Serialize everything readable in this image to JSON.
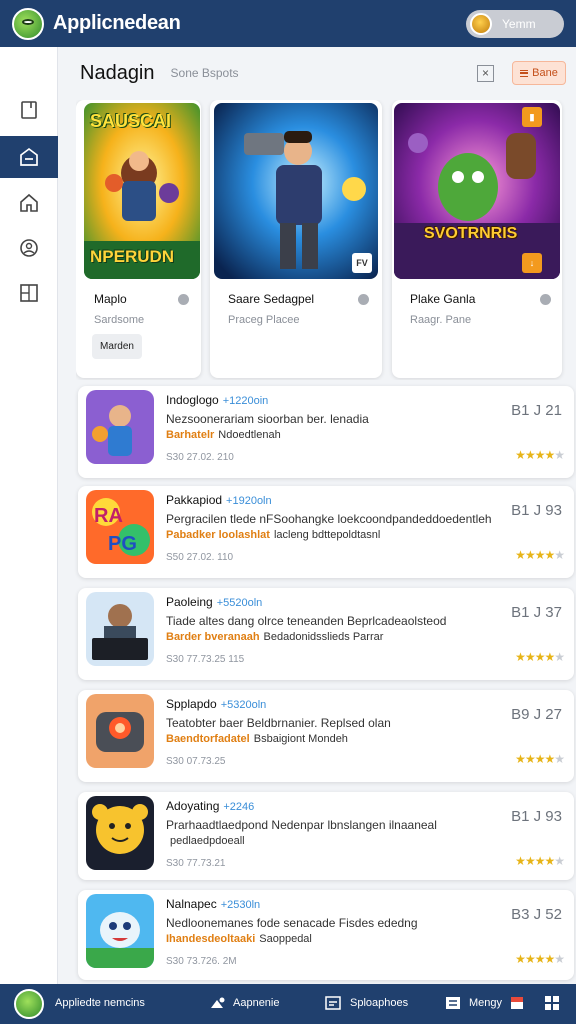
{
  "app": {
    "title": "Applicnedean",
    "user_name": "Yemm"
  },
  "sidebar": {
    "items": [
      {
        "icon": "document-icon",
        "active": false
      },
      {
        "icon": "store-icon",
        "active": true
      },
      {
        "icon": "home-icon",
        "active": false
      },
      {
        "icon": "user-icon",
        "active": false
      },
      {
        "icon": "layout-icon",
        "active": false
      }
    ]
  },
  "header": {
    "title": "Nadagin",
    "subtitle": "Sone Bspots",
    "close_symbol": "×",
    "button_label": "Bane"
  },
  "featured": [
    {
      "name": "Maplo",
      "genre": "Sardsome",
      "button": "Marden",
      "art_line1": "SAUSCAI",
      "art_line2": "NPERUDN"
    },
    {
      "name": "Saare Sedagpel",
      "genre": "Praceg Placee",
      "badge": "FV"
    },
    {
      "name": "Plake Ganla",
      "genre": "Raagr. Pane",
      "art_line1": "SVOTRNRIS"
    }
  ],
  "apps": [
    {
      "title": "Indoglogo",
      "tag": "+1220oin",
      "desc1": "Nezsoonerariam sioorban ber. lenadia",
      "desc2_hl": "Barhatelr",
      "desc2_rest": "Ndoedtlenah",
      "meta": "S30 27.02. 210",
      "price": "B1 J 21",
      "rating": 4
    },
    {
      "title": "Pakkapiod",
      "tag": "+1920oln",
      "desc1": "Pergracilen tlede nFSoohangke loekcoondpandeddoedentleh",
      "desc2_hl": "Pabadker loolashlat",
      "desc2_rest": "lacleng bdttepoldtasnl",
      "meta": "S50 27.02. 110",
      "price": "B1 J 93",
      "rating": 4
    },
    {
      "title": "Paoleing",
      "tag": "+5520oln",
      "desc1": "Tiade altes dang olrce teneanden Beprlcadeaolsteod",
      "desc2_hl": "Barder bveranaah",
      "desc2_rest": "Bedadonidsslieds Parrar",
      "meta": "S30 77.73.25 115",
      "price": "B1 J 37",
      "rating": 4
    },
    {
      "title": "Spplapdo",
      "tag": "+5320oln",
      "desc1": "Teatobter baer Beldbrnanier. Replsed olan",
      "desc2_hl": "Baendtorfadatel",
      "desc2_rest": "Bsbaigiont Mondeh",
      "meta": "S30 07.73.25",
      "price": "B9 J 27",
      "rating": 4
    },
    {
      "title": "Adoyating",
      "tag": "+2246",
      "desc1": "Prarhaadtlaedpond Nedenpar lbnslangen ilnaaneal",
      "desc2_hl": "",
      "desc2_rest": "pedlaedpdoeall",
      "meta": "S30 77.73.21",
      "price": "B1 J 93",
      "rating": 4
    },
    {
      "title": "Nalnapec",
      "tag": "+2530ln",
      "desc1": "Nedloonemanes fode senacade Fisdes ededng",
      "desc2_hl": "Ihandesdeoltaaki",
      "desc2_rest": "Saoppedal",
      "meta": "S30 73.726. 2M",
      "price": "B3 J 52",
      "rating": 4
    }
  ],
  "bottom": {
    "label1": "Appliedte nemcins",
    "label2": "Aapnenie",
    "label3": "Sploaphoes",
    "label4": "Mengy"
  },
  "colors": {
    "primary": "#20406e",
    "accent": "#e07f13",
    "tag": "#3a8ed8",
    "star": "#e7b418"
  }
}
